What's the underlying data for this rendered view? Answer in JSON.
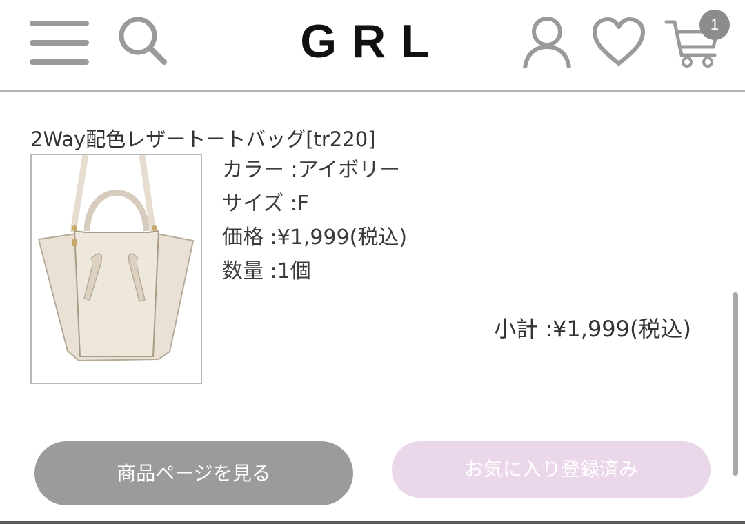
{
  "header": {
    "logo": "GRL",
    "cart_count": "1",
    "icons": {
      "menu": "hamburger-icon",
      "search": "search-icon",
      "account": "user-icon",
      "favorites": "heart-icon",
      "cart": "cart-icon"
    }
  },
  "product": {
    "name": "2Way配色レザートートバッグ[tr220]",
    "color": "カラー :アイボリー",
    "size": "サイズ :F",
    "price": "価格 :¥1,999(税込)",
    "quantity": "数量 :1個",
    "subtotal": "小計 :¥1,999(税込)"
  },
  "buttons": {
    "view_product": "商品ページを見る",
    "favorite_registered": "お気に入り登録済み"
  },
  "colors": {
    "primary_button": "#9b9b9b",
    "favorite_button": "#ead7e9",
    "icon_gray": "#9a9a9a",
    "badge": "#8c8c8c"
  }
}
